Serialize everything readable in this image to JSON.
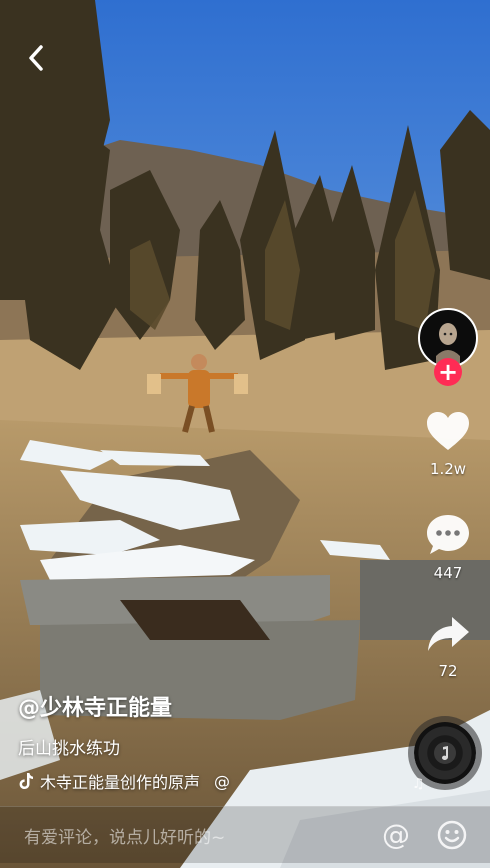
{
  "video": {
    "author": "@少林寺正能量",
    "description": "后山挑水练功",
    "music": "木寺正能量创作的原声",
    "music_mention": "@"
  },
  "rail": {
    "like_count": "1.2w",
    "comment_count": "447",
    "share_count": "72",
    "follow_symbol": "+"
  },
  "comment": {
    "placeholder": "有爱评论，说点儿好听的~",
    "mention_symbol": "@"
  },
  "colors": {
    "sky": "#3f86d8",
    "follow_accent": "#ff2c55",
    "snow": "#eef3f6",
    "pine": "#5a5030"
  },
  "icons": [
    "back-arrow-icon",
    "heart-icon",
    "comment-bubble-icon",
    "share-arrow-icon",
    "music-note-icon",
    "tiktok-note-icon",
    "emoji-icon"
  ]
}
